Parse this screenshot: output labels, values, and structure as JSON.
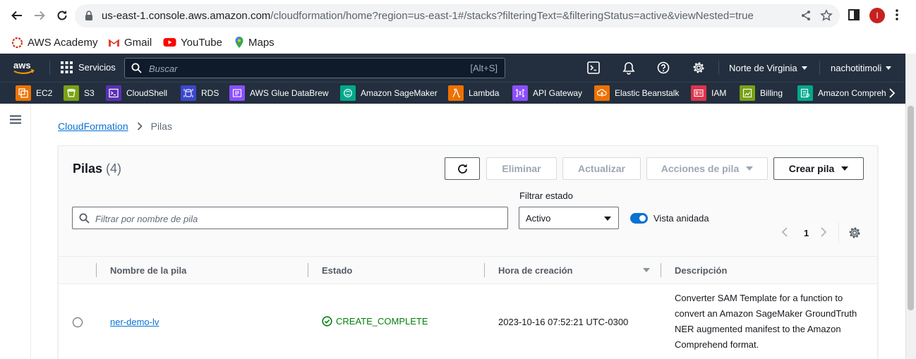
{
  "browser": {
    "url_host": "us-east-1.console.aws.amazon.com",
    "url_path": "/cloudformation/home?region=us-east-1#/stacks?filteringText=&filteringStatus=active&viewNested=true",
    "avatar_letter": "I",
    "bookmarks": [
      {
        "label": "AWS Academy",
        "icon": "aws-academy-icon"
      },
      {
        "label": "Gmail",
        "icon": "gmail-icon"
      },
      {
        "label": "YouTube",
        "icon": "youtube-icon"
      },
      {
        "label": "Maps",
        "icon": "maps-icon"
      }
    ]
  },
  "aws_nav": {
    "services_label": "Servicios",
    "search_placeholder": "Buscar",
    "search_shortcut": "[Alt+S]",
    "region_label": "Norte de Virginia",
    "user_label": "nachotitimoli"
  },
  "favorites": [
    {
      "label": "EC2",
      "color": "#ed7100"
    },
    {
      "label": "S3",
      "color": "#7aa116"
    },
    {
      "label": "CloudShell",
      "color": "#5a30b5"
    },
    {
      "label": "RDS",
      "color": "#3b48cc"
    },
    {
      "label": "AWS Glue DataBrew",
      "color": "#8c4fff"
    },
    {
      "label": "Amazon SageMaker",
      "color": "#01a88d"
    },
    {
      "label": "Lambda",
      "color": "#ed7100"
    },
    {
      "label": "API Gateway",
      "color": "#8c4fff"
    },
    {
      "label": "Elastic Beanstalk",
      "color": "#ed7100"
    },
    {
      "label": "IAM",
      "color": "#dd344c"
    },
    {
      "label": "Billing",
      "color": "#7aa116"
    },
    {
      "label": "Amazon Compreh",
      "color": "#01a88d"
    }
  ],
  "breadcrumb": {
    "root": "CloudFormation",
    "current": "Pilas"
  },
  "stacks": {
    "title": "Pilas",
    "count": "(4)",
    "buttons": {
      "delete": "Eliminar",
      "update": "Actualizar",
      "actions": "Acciones de pila",
      "create": "Crear pila"
    },
    "filter_placeholder": "Filtrar por nombre de pila",
    "status_label": "Filtrar estado",
    "status_value": "Activo",
    "nested_label": "Vista anidada",
    "nested_enabled": true,
    "page": "1",
    "columns": {
      "name": "Nombre de la pila",
      "status": "Estado",
      "created": "Hora de creación",
      "description": "Descripción"
    },
    "rows": [
      {
        "name": "ner-demo-lv",
        "status": "CREATE_COMPLETE",
        "created": "2023-10-16 07:52:21 UTC-0300",
        "description": "Converter SAM Template for a function to convert an Amazon SageMaker GroundTruth NER augmented manifest to the Amazon Comprehend format."
      }
    ]
  },
  "colors": {
    "nav_bg": "#232f3e",
    "link": "#0972d3",
    "success": "#037f0c",
    "toggle_on": "#0972d3"
  }
}
